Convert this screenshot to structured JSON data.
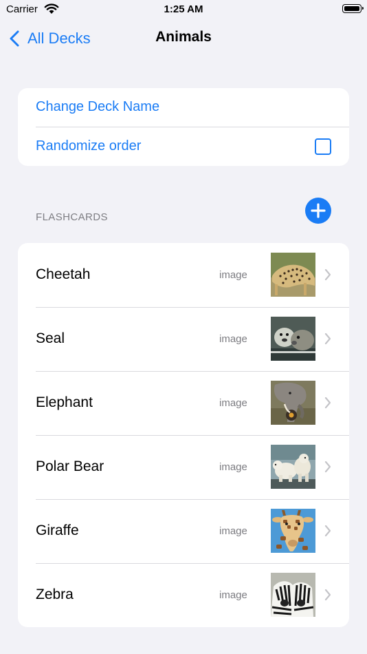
{
  "status_bar": {
    "carrier": "Carrier",
    "time": "1:25 AM"
  },
  "nav": {
    "back_label": "All Decks",
    "title": "Animals"
  },
  "settings": {
    "change_name_label": "Change Deck Name",
    "randomize_label": "Randomize order",
    "randomize_checked": false
  },
  "flashcards": {
    "header": "FLASHCARDS",
    "items": [
      {
        "name": "Cheetah",
        "type": "image"
      },
      {
        "name": "Seal",
        "type": "image"
      },
      {
        "name": "Elephant",
        "type": "image"
      },
      {
        "name": "Polar Bear",
        "type": "image"
      },
      {
        "name": "Giraffe",
        "type": "image"
      },
      {
        "name": "Zebra",
        "type": "image"
      }
    ]
  },
  "colors": {
    "accent": "#1a7cf5",
    "background": "#f2f2f7",
    "secondary_text": "#7d7d82"
  }
}
